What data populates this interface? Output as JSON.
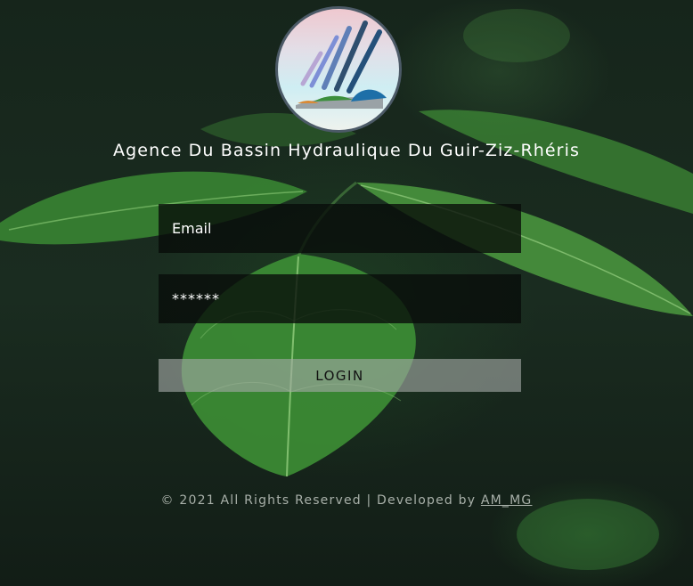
{
  "header": {
    "title": "Agence Du Bassin Hydraulique Du Guir-Ziz-Rhéris"
  },
  "form": {
    "email_placeholder": "Email",
    "password_value": "******",
    "login_label": "LOGIN"
  },
  "footer": {
    "text": "© 2021 All Rights Reserved | Developed by",
    "link_text": "AM_MG"
  },
  "colors": {
    "background": "#14231a",
    "leaf": "#3f8f3a",
    "field_bg": "#080c09",
    "button_bg": "#a5aaa6"
  },
  "icons": [
    "logo-emblem",
    "background-leaves-image"
  ]
}
